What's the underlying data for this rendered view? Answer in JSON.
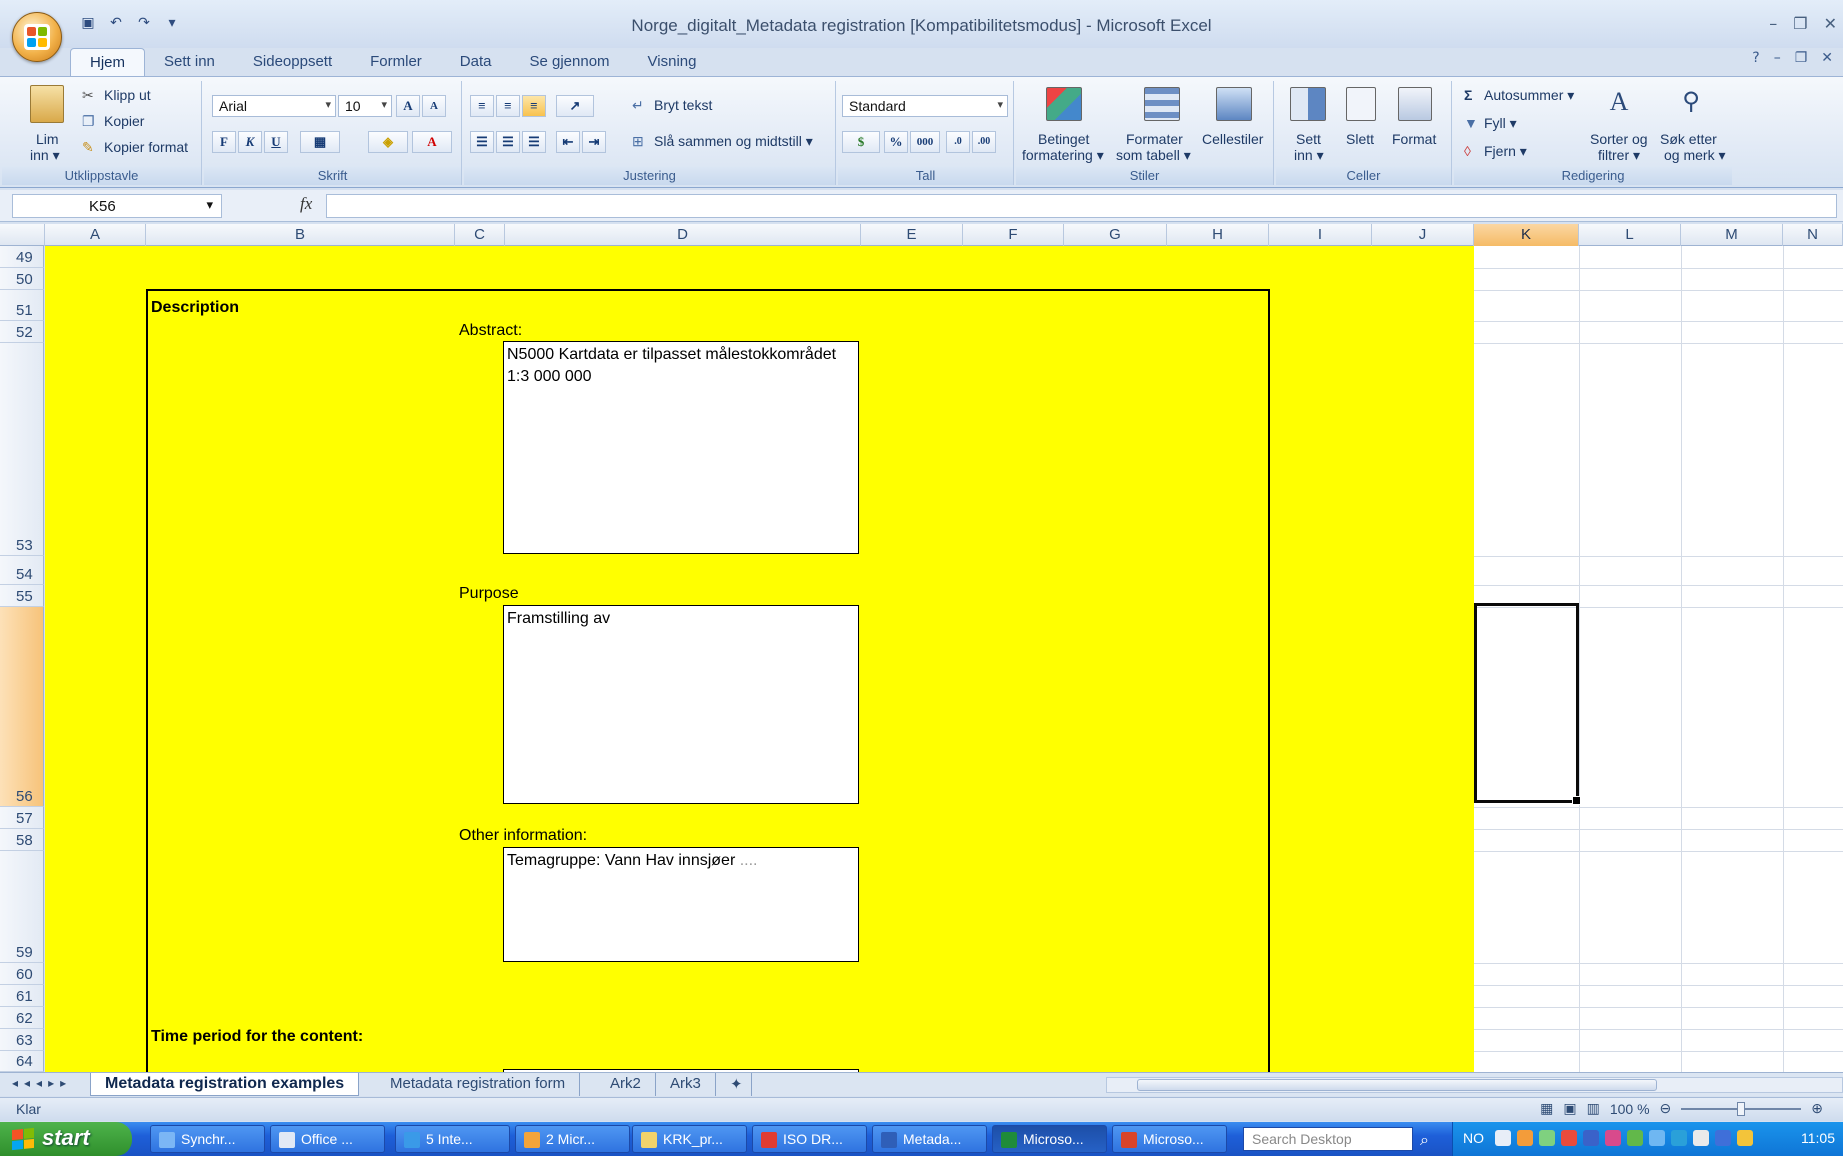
{
  "window": {
    "title": "Norge_digitalt_Metadata registration  [Kompatibilitetsmodus] - Microsoft Excel"
  },
  "ribbon": {
    "tabs": [
      "Hjem",
      "Sett inn",
      "Sideoppsett",
      "Formler",
      "Data",
      "Se gjennom",
      "Visning"
    ],
    "active_tab": "Hjem",
    "clipboard": {
      "paste": "Lim",
      "paste2": "inn ▾",
      "cut": "Klipp ut",
      "copy": "Kopier",
      "format_painter": "Kopier format",
      "group": "Utklippstavle"
    },
    "font": {
      "name": "Arial",
      "size": "10",
      "bold": "F",
      "italic": "K",
      "underline": "U",
      "group": "Skrift"
    },
    "alignment": {
      "wrap": "Bryt tekst",
      "merge": "Slå sammen og midtstill ▾",
      "group": "Justering"
    },
    "number": {
      "format": "Standard",
      "percent": "%",
      "thousands": "000",
      "group": "Tall"
    },
    "styles": {
      "conditional": "Betinget",
      "conditional2": "formatering ▾",
      "table": "Formater",
      "table2": "som tabell ▾",
      "cell": "Cellestiler",
      "group": "Stiler"
    },
    "cells": {
      "insert": "Sett",
      "insert2": "inn ▾",
      "delete": "Slett",
      "format": "Format",
      "group": "Celler"
    },
    "editing": {
      "autosum": "Autosummer ▾",
      "fill": "Fyll ▾",
      "clear": "Fjern ▾",
      "sort": "Sorter og",
      "sort2": "filtrer ▾",
      "find": "Søk etter",
      "find2": "og merk ▾",
      "group": "Redigering"
    }
  },
  "formula_bar": {
    "name_box": "K56",
    "fx": "fx",
    "content": ""
  },
  "columns": [
    "A",
    "B",
    "C",
    "D",
    "E",
    "F",
    "G",
    "H",
    "I",
    "J",
    "K",
    "L",
    "M",
    "N"
  ],
  "selected_column": "K",
  "rows": [
    "49",
    "50",
    "51",
    "52",
    "53",
    "54",
    "55",
    "56",
    "57",
    "58",
    "59",
    "60",
    "61",
    "62",
    "63",
    "64"
  ],
  "selected_row": "56",
  "sheet": {
    "description_label": "Description",
    "abstract_label": "Abstract:",
    "abstract_value": "N5000 Kartdata er tilpasset målestokkområdet 1:3 000 000",
    "purpose_label": "Purpose",
    "purpose_value": "Framstilling av",
    "other_label": "Other information:",
    "other_value": "Temagruppe: Vann Hav innsjøer",
    "other_value_tail": "....",
    "time_label": "Time period for the content:"
  },
  "sheet_tabs": [
    "Metadata registration examples",
    "Metadata registration form",
    "Ark2",
    "Ark3"
  ],
  "active_sheet": "Metadata registration examples",
  "status": {
    "ready": "Klar",
    "zoom": "100 %"
  },
  "taskbar": {
    "start": "start",
    "buttons": [
      "Synchr...",
      "Office ...",
      "5 Inte...",
      "2 Micr...",
      "KRK_pr...",
      "ISO DR...",
      "Metada...",
      "Microso...",
      "Microso..."
    ],
    "search_placeholder": "Search Desktop",
    "lang": "NO",
    "clock": "11:05"
  },
  "colors": {
    "sheet_fill": "#ffff00",
    "selected_header": "#f7c37a"
  }
}
